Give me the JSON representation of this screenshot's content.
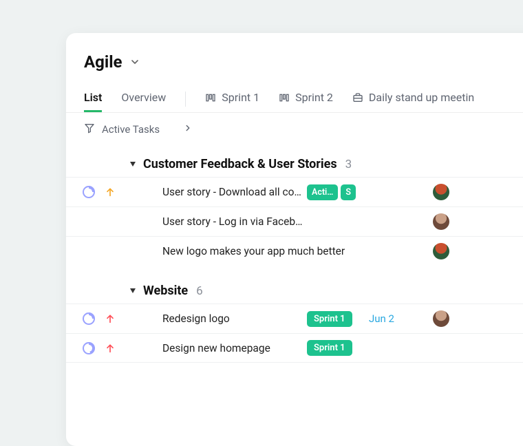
{
  "header": {
    "title": "Agile"
  },
  "tabs": {
    "list": "List",
    "overview": "Overview",
    "sprint1": "Sprint 1",
    "sprint2": "Sprint 2",
    "daily": "Daily stand up meetin"
  },
  "filter": {
    "label": "Active Tasks"
  },
  "groups": {
    "feedback": {
      "title": "Customer Feedback & User Stories",
      "count": "3",
      "rows": [
        {
          "name": "User story - Download all con…",
          "badges": [
            "Acti…",
            "S"
          ],
          "date": "",
          "avatar": "a",
          "priority": "orange",
          "pie": "25%"
        },
        {
          "name": "User story - Log in via Facebook",
          "badges": [],
          "date": "",
          "avatar": "b",
          "priority": "",
          "pie": ""
        },
        {
          "name": "New logo makes your app much better",
          "badges": [],
          "date": "",
          "avatar": "a",
          "priority": "",
          "pie": ""
        }
      ]
    },
    "website": {
      "title": "Website",
      "count": "6",
      "rows": [
        {
          "name": "Redesign logo",
          "badges": [
            "Sprint 1"
          ],
          "date": "Jun 2",
          "avatar": "b",
          "priority": "red",
          "pie": "25%"
        },
        {
          "name": "Design new homepage",
          "badges": [
            "Sprint 1"
          ],
          "date": "",
          "avatar": "",
          "priority": "red",
          "pie": "45%"
        }
      ]
    }
  }
}
